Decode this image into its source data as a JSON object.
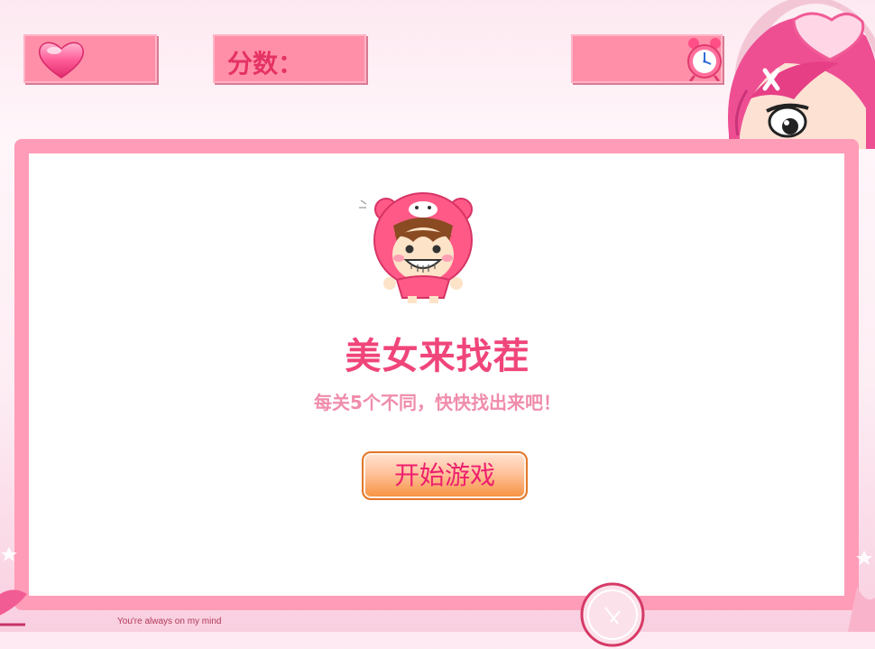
{
  "hud": {
    "lives_icon": "heart-icon",
    "score_label": "分数：",
    "timer_icon": "alarm-clock-icon"
  },
  "start_screen": {
    "title": "美女来找茬",
    "subtitle": "每关5个不同，快快找出来吧！",
    "start_button": "开始游戏"
  },
  "footer": {
    "tagline": "You're always on my mind"
  },
  "colors": {
    "accent": "#f0457a",
    "panel_border": "#ff9cb8",
    "hud_box": "#ff8fa9",
    "button_border": "#e2782a",
    "button_text": "#ee1f6e"
  }
}
